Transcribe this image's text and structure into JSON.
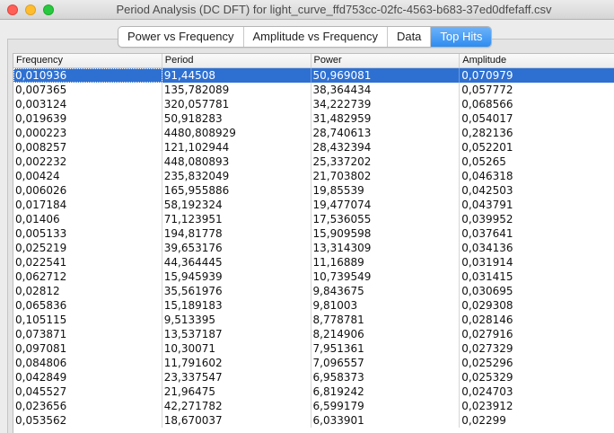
{
  "window": {
    "title": "Period Analysis (DC DFT) for light_curve_ffd753cc-02fc-4563-b683-37ed0dfefaff.csv"
  },
  "tabs": [
    {
      "label": "Power vs Frequency",
      "active": false
    },
    {
      "label": "Amplitude vs Frequency",
      "active": false
    },
    {
      "label": "Data",
      "active": false
    },
    {
      "label": "Top Hits",
      "active": true
    }
  ],
  "table": {
    "columns": [
      "Frequency",
      "Period",
      "Power",
      "Amplitude"
    ],
    "selected_row": 0,
    "rows": [
      [
        "0,010936",
        "91,44508",
        "50,969081",
        "0,070979"
      ],
      [
        "0,007365",
        "135,782089",
        "38,364434",
        "0,057772"
      ],
      [
        "0,003124",
        "320,057781",
        "34,222739",
        "0,068566"
      ],
      [
        "0,019639",
        "50,918283",
        "31,482959",
        "0,054017"
      ],
      [
        "0,000223",
        "4480,808929",
        "28,740613",
        "0,282136"
      ],
      [
        "0,008257",
        "121,102944",
        "28,432394",
        "0,052201"
      ],
      [
        "0,002232",
        "448,080893",
        "25,337202",
        "0,05265"
      ],
      [
        "0,00424",
        "235,832049",
        "21,703802",
        "0,046318"
      ],
      [
        "0,006026",
        "165,955886",
        "19,85539",
        "0,042503"
      ],
      [
        "0,017184",
        "58,192324",
        "19,477074",
        "0,043791"
      ],
      [
        "0,01406",
        "71,123951",
        "17,536055",
        "0,039952"
      ],
      [
        "0,005133",
        "194,81778",
        "15,909598",
        "0,037641"
      ],
      [
        "0,025219",
        "39,653176",
        "13,314309",
        "0,034136"
      ],
      [
        "0,022541",
        "44,364445",
        "11,16889",
        "0,031914"
      ],
      [
        "0,062712",
        "15,945939",
        "10,739549",
        "0,031415"
      ],
      [
        "0,02812",
        "35,561976",
        "9,843675",
        "0,030695"
      ],
      [
        "0,065836",
        "15,189183",
        "9,81003",
        "0,029308"
      ],
      [
        "0,105115",
        "9,513395",
        "8,778781",
        "0,028146"
      ],
      [
        "0,073871",
        "13,537187",
        "8,214906",
        "0,027916"
      ],
      [
        "0,097081",
        "10,30071",
        "7,951361",
        "0,027329"
      ],
      [
        "0,084806",
        "11,791602",
        "7,096557",
        "0,025296"
      ],
      [
        "0,042849",
        "23,337547",
        "6,958373",
        "0,025329"
      ],
      [
        "0,045527",
        "21,96475",
        "6,819242",
        "0,024703"
      ],
      [
        "0,023656",
        "42,271782",
        "6,599179",
        "0,023912"
      ],
      [
        "0,053562",
        "18,670037",
        "6,033901",
        "0,02299"
      ]
    ]
  },
  "colors": {
    "selection": "#2e70d2",
    "tab_active": "#2f8cf0"
  }
}
